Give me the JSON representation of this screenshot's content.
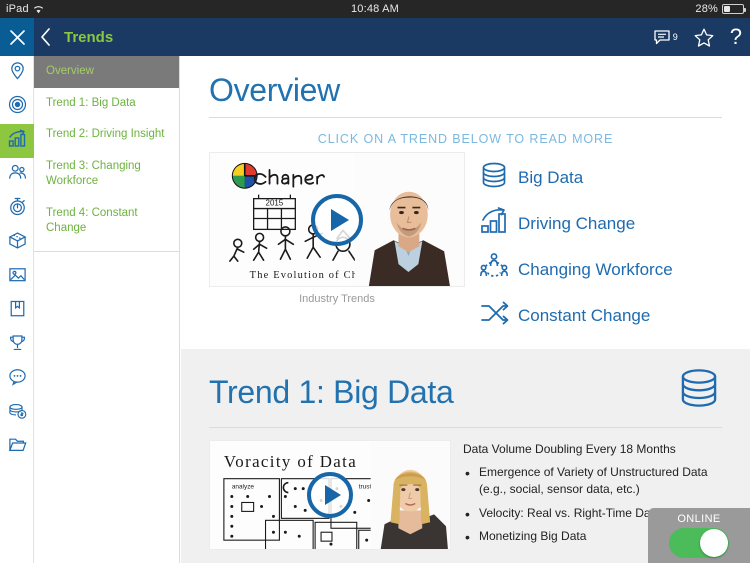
{
  "status_bar": {
    "device": "iPad",
    "wifi_icon": "wifi-icon",
    "time": "10:48 AM",
    "battery_text": "28%",
    "battery_icon": "battery-icon"
  },
  "navbar": {
    "close_icon": "close-icon",
    "back_icon": "chevron-left-icon",
    "title": "Trends",
    "comments_icon": "comment-icon",
    "comments_count": "9",
    "favorite_icon": "star-icon",
    "help_icon": "question-mark-icon",
    "bg_color": "#1b3a63",
    "accent_color": "#8dc63f"
  },
  "rail": {
    "active_color": "#8dc63f",
    "icon_color": "#1f6bb0",
    "items": [
      {
        "icon": "location-pin-icon",
        "active": false
      },
      {
        "icon": "target-icon",
        "active": false
      },
      {
        "icon": "bar-chart-trend-icon",
        "active": true
      },
      {
        "icon": "people-icon",
        "active": false
      },
      {
        "icon": "stopwatch-icon",
        "active": false
      },
      {
        "icon": "package-icon",
        "active": false
      },
      {
        "icon": "image-icon",
        "active": false
      },
      {
        "icon": "book-icon",
        "active": false
      },
      {
        "icon": "trophy-icon",
        "active": false
      },
      {
        "icon": "speech-bubble-icon",
        "active": false
      },
      {
        "icon": "money-stack-icon",
        "active": false
      },
      {
        "icon": "folder-icon",
        "active": false
      }
    ]
  },
  "sidenav": {
    "selected_bg": "#7a7a7a",
    "link_color": "#6cb33f",
    "items": [
      {
        "label": "Overview",
        "selected": true
      },
      {
        "label": "Trend 1: Big Data",
        "selected": false
      },
      {
        "label": "Trend 2: Driving Insight",
        "selected": false
      },
      {
        "label": "Trend 3: Changing Workforce",
        "selected": false
      },
      {
        "label": "Trend 4: Constant Change",
        "selected": false
      }
    ]
  },
  "overview": {
    "title": "Overview",
    "hint": "CLICK ON A TREND BELOW TO READ MORE",
    "video": {
      "caption": "Industry Trends",
      "sketch_title": "Change",
      "sketch_year": "2015",
      "sketch_caption": "The Evolution of Change",
      "play_icon": "play-icon"
    },
    "trend_links": [
      {
        "label": "Big Data",
        "icon": "database-icon"
      },
      {
        "label": "Driving Change",
        "icon": "bar-chart-arrow-icon"
      },
      {
        "label": "Changing Workforce",
        "icon": "people-network-icon"
      },
      {
        "label": "Constant Change",
        "icon": "shuffle-arrows-icon"
      }
    ]
  },
  "trend1": {
    "title": "Trend 1: Big Data",
    "icon": "database-icon",
    "video": {
      "sketch_title": "Voracity of Data",
      "sketch_label_1": "analyze",
      "sketch_label_2": "trust",
      "play_icon": "play-icon"
    },
    "headline": "Data Volume Doubling Every 18 Months",
    "bullets": [
      "Emergence of Variety of Unstructured Data (e.g., social, sensor data, etc.)",
      "Velocity: Real vs. Right-Time Data",
      "Monetizing Big Data"
    ]
  },
  "online_widget": {
    "label": "ONLINE",
    "state": "on",
    "on_color": "#4cbb5a",
    "bg_color": "#9a9a9a"
  }
}
